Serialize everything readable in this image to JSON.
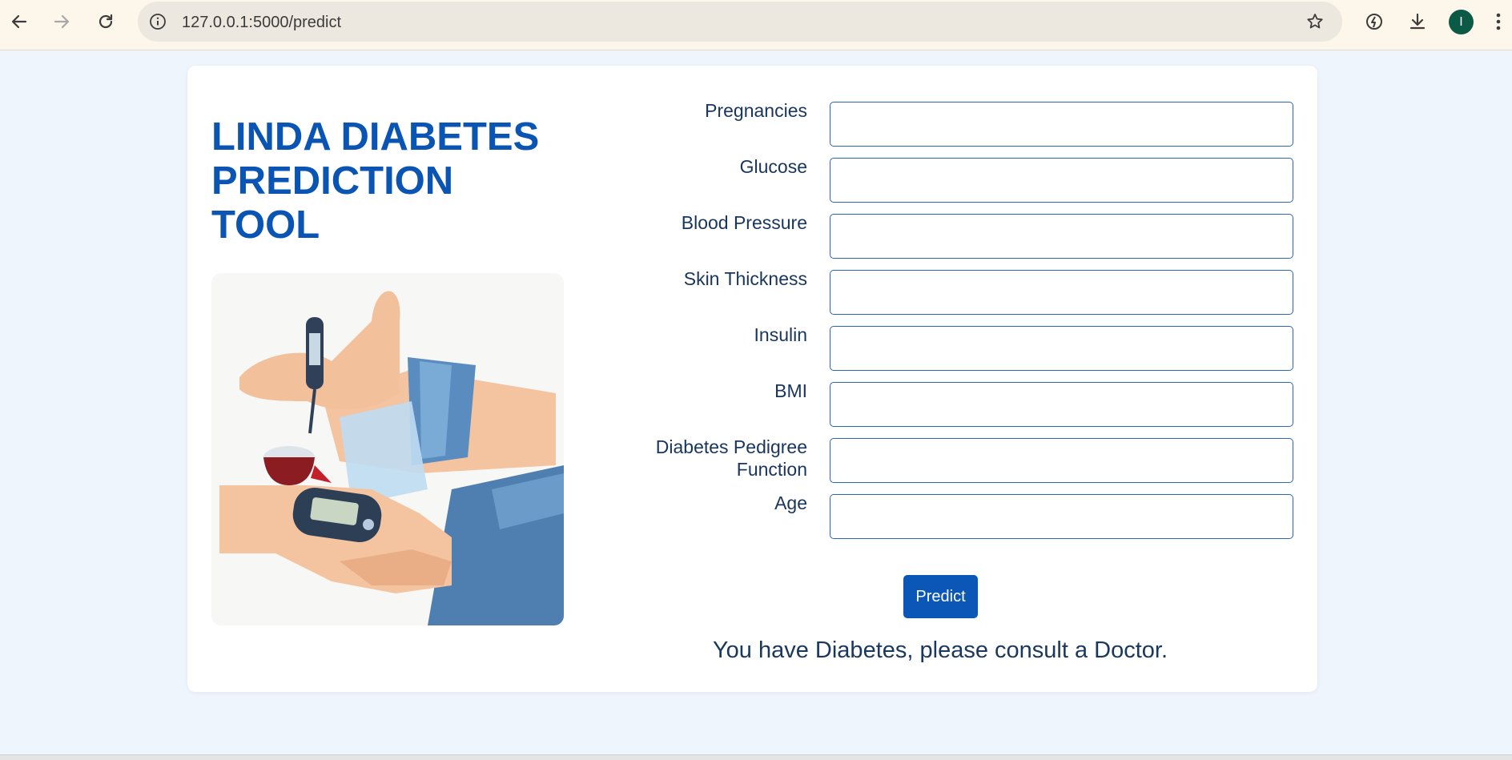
{
  "browser": {
    "url": "127.0.0.1:5000/predict",
    "profile_initial": "I"
  },
  "page": {
    "title": "LINDA DIABETES PREDICTION TOOL",
    "illustration_alt": "glucose-meter-illustration",
    "fields": [
      {
        "label": "Pregnancies",
        "value": "",
        "placeholder": ""
      },
      {
        "label": "Glucose",
        "value": "",
        "placeholder": ""
      },
      {
        "label": "Blood Pressure",
        "value": "",
        "placeholder": ""
      },
      {
        "label": "Skin Thickness",
        "value": "",
        "placeholder": ""
      },
      {
        "label": "Insulin",
        "value": "",
        "placeholder": ""
      },
      {
        "label": "BMI",
        "value": "",
        "placeholder": ""
      },
      {
        "label": "Diabetes Pedigree Function",
        "value": "",
        "placeholder": ""
      },
      {
        "label": "Age",
        "value": "",
        "placeholder": ""
      }
    ],
    "predict_label": "Predict",
    "result_text": "You have Diabetes, please consult a Doctor."
  },
  "colors": {
    "accent": "#0b57b8",
    "title": "#0a55b4",
    "page_background": "#eef5fc"
  }
}
